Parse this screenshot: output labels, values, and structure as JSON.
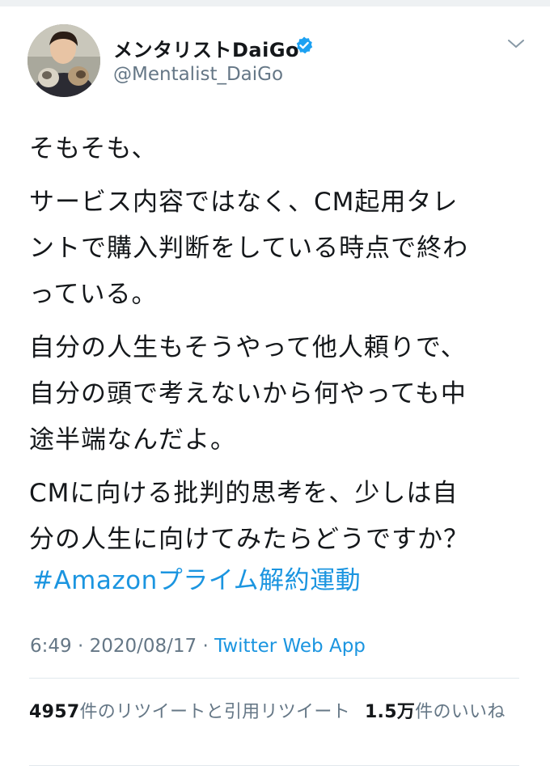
{
  "tweet": {
    "display_name": "メンタリストDaiGo",
    "handle": "@Mentalist_DaiGo",
    "verified_icon": "verified-badge-icon",
    "menu_icon": "chevron-down-icon",
    "paragraphs": [
      [
        "そもそも、"
      ],
      [
        "サービス内容ではなく、CM起用タレ",
        "ントで購入判断をしている時点で終わ",
        "っている。"
      ],
      [
        "自分の人生もそうやって他人頼りで、",
        "自分の頭で考えないから何やっても中",
        "途半端なんだよ。"
      ],
      [
        "CMに向ける批判的思考を、少しは自",
        "分の人生に向けてみたらどうですか？"
      ]
    ],
    "hashtag": "#Amazonプライム解約運動",
    "time": "6:49",
    "date": "2020/08/17",
    "separator": "·",
    "source": "Twitter Web App",
    "retweets_count": "4957",
    "retweets_label": "件のリツイートと引用リツイート",
    "likes_count": "1.5万",
    "likes_label": "件のいいね"
  },
  "colors": {
    "link_blue": "#1b95e0",
    "muted_gray": "#657786",
    "divider": "#e1e8ed",
    "verified_blue": "#1da1f2"
  }
}
